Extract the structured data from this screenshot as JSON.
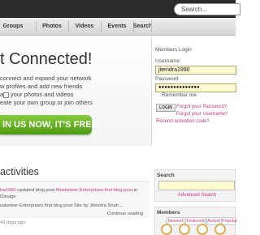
{
  "topbar": {
    "search_placeholder": "Search..."
  },
  "nav": {
    "items": [
      "Groups",
      "Photos",
      "Videos",
      "Events",
      "Search"
    ]
  },
  "hero": {
    "title": "t Connected!",
    "lines": [
      "connect and expand your network",
      "w profiles and add new friends",
      "are your photos and videos",
      "eate your own group or join others"
    ],
    "join_button": "IN US NOW, IT'S FREE!"
  },
  "login": {
    "title": "Members Login",
    "username_label": "Username",
    "username_value": "jitendra1990",
    "password_label": "Password",
    "password_value": "●●●●●●●●●●●●●●",
    "remember_label": "Remember me",
    "login_button": "LOGIN",
    "forgot_password": "Forgot your Password?",
    "forgot_username": "Forgot your Username?",
    "resend_activation": "Resend activation code?"
  },
  "activities": {
    "title": "activities",
    "line1_user": "tra1990",
    "line1_text": " updated blog post ",
    "line1_link": "Musketeer Enterprises first blog post",
    "line1_suffix": " in",
    "line2": "IDesign",
    "line3": "usketeer Enterprises first blog post Site by Jitendra Shah ...",
    "continue": "Continue reading",
    "time": "42 days ago"
  },
  "sidebar": {
    "search_title": "Search",
    "advanced_search": "Advanced Search",
    "members_title": "Members",
    "tabs": [
      "Newest",
      "Featured",
      "Active",
      "Popular"
    ]
  },
  "colors": {
    "accent": "#d33682",
    "join_green": "#5aaa1a"
  }
}
